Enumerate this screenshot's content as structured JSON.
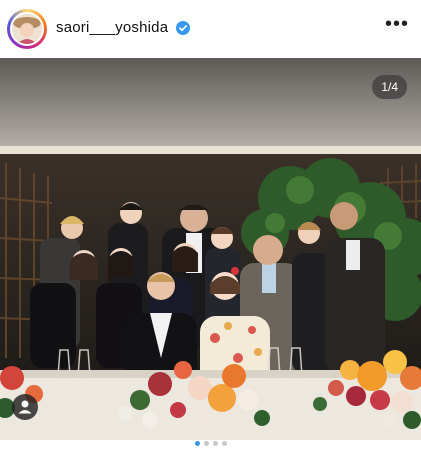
{
  "post": {
    "username": "saori___yoshida",
    "verified": true,
    "more_icon": "more-horizontal-icon",
    "image_counter": "1/4",
    "carousel": {
      "total": 4,
      "current": 1
    },
    "tag_icon": "user-tag-icon"
  },
  "colors": {
    "verified": "#3897f0",
    "active_dot": "#3897f0",
    "inactive_dot": "#c9c9c9"
  }
}
